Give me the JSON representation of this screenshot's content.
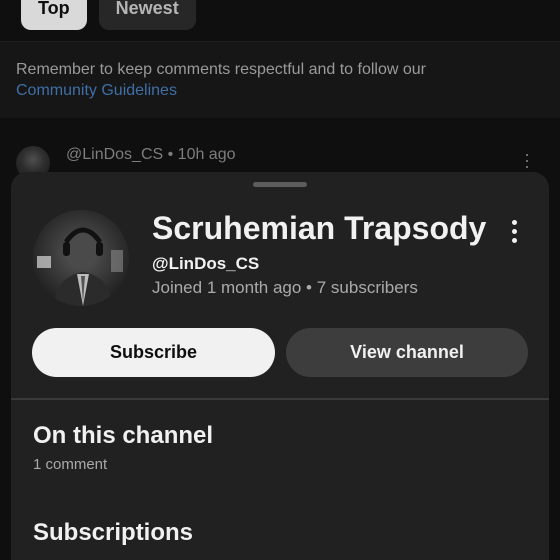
{
  "filters": {
    "top_label": "Top",
    "newest_label": "Newest"
  },
  "notice": {
    "text": "Remember to keep comments respectful and to follow our",
    "link_text": "Community Guidelines"
  },
  "comment": {
    "handle": "@LinDos_CS",
    "time": "10h ago",
    "meta": "@LinDos_CS • 10h ago"
  },
  "channel_card": {
    "name": "Scruhemian Trapsody",
    "handle": "@LinDos_CS",
    "joined_line": "Joined 1 month ago • 7 subscribers",
    "subscribe_label": "Subscribe",
    "view_channel_label": "View channel"
  },
  "on_this_channel": {
    "title": "On this channel",
    "subtitle": "1 comment"
  },
  "subscriptions": {
    "title": "Subscriptions"
  },
  "icons": {
    "more": "more-vert-icon",
    "avatar": "channel-avatar"
  },
  "colors": {
    "background": "#0f0f0f",
    "sheet": "#212121",
    "link": "#3e6fa6",
    "primary_button": "#f1f1f1",
    "secondary_button": "#3d3d3d"
  }
}
